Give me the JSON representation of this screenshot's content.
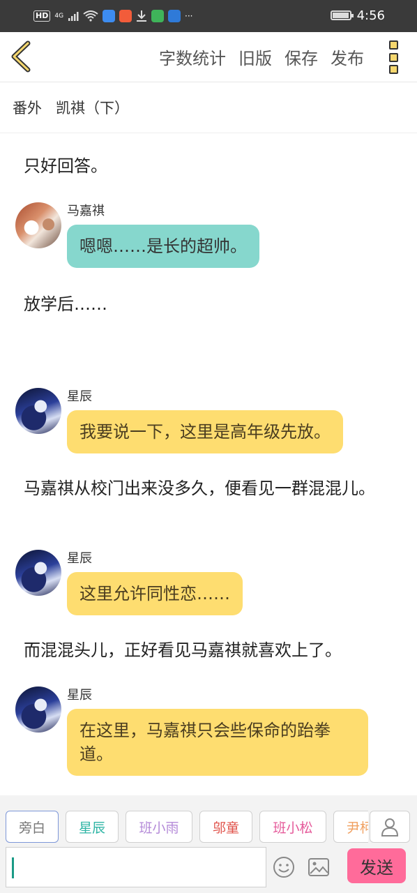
{
  "status_bar": {
    "hd": "HD",
    "net": "4G",
    "more": "···",
    "time": "4:56"
  },
  "toolbar": {
    "actions": [
      "字数统计",
      "旧版",
      "保存",
      "发布"
    ]
  },
  "chapter": {
    "label": "番外",
    "title": "凯祺（下）"
  },
  "story": [
    {
      "type": "narration",
      "text": "只好回答。"
    },
    {
      "type": "message",
      "speaker": "马嘉祺",
      "text": "嗯嗯……是长的超帅。",
      "bubble_color": "#86d7cd"
    },
    {
      "type": "narration",
      "text": "放学后……"
    },
    {
      "type": "message",
      "speaker": "星辰",
      "text": "我要说一下，这里是高年级先放。",
      "bubble_color": "#fedd70"
    },
    {
      "type": "narration",
      "text": "马嘉祺从校门出来没多久，便看见一群混混儿。"
    },
    {
      "type": "message",
      "speaker": "星辰",
      "text": "这里允许同性恋……",
      "bubble_color": "#fedd70"
    },
    {
      "type": "narration",
      "text": "而混混头儿，正好看见马嘉祺就喜欢上了。"
    },
    {
      "type": "message",
      "speaker": "星辰",
      "text": "在这里，马嘉祺只会些保命的跆拳道。",
      "bubble_color": "#fedd70"
    }
  ],
  "characters": [
    {
      "name": "旁白",
      "color": "#777777"
    },
    {
      "name": "星辰",
      "color": "#2fb5a5"
    },
    {
      "name": "班小雨",
      "color": "#b48ad8"
    },
    {
      "name": "邬童",
      "color": "#e0524a"
    },
    {
      "name": "班小松",
      "color": "#e55a9a"
    },
    {
      "name": "尹柯",
      "color": "#f0a060"
    }
  ],
  "composer": {
    "input_value": "",
    "send_label": "发送"
  }
}
